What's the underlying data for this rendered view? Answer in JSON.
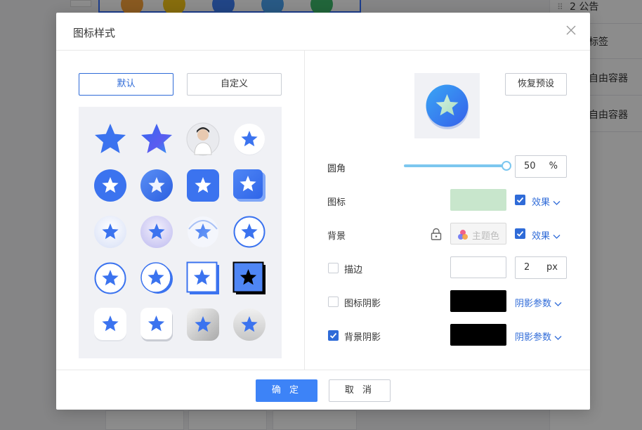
{
  "background": {
    "sidebar_items": [
      "2 公告",
      "标签",
      "自由容器",
      "自由容器"
    ]
  },
  "dialog": {
    "title": "图标样式",
    "close_label": "X",
    "tabs": [
      {
        "label": "默认",
        "active": true
      },
      {
        "label": "自定义",
        "active": false
      }
    ],
    "icon_styles": [
      "star-flat",
      "star-gradient",
      "avatar-photo",
      "star-in-white-circle",
      "star-in-blue-circle",
      "star-in-gradient-circle",
      "star-in-blue-square",
      "star-in-square-3d",
      "star-in-soft-circle",
      "star-in-lavender-circle",
      "star-in-glow-circle",
      "star-in-outline-circle",
      "star-in-outline-circle-thick",
      "star-in-outline-circle-shadow",
      "star-in-outline-square",
      "black-star-in-square",
      "star-in-white-rounded-square",
      "star-in-white-rounded-square-shadow",
      "star-in-grey-rounded-square",
      "star-in-grey-circle"
    ],
    "reset_label": "恢复预设",
    "settings": {
      "radius": {
        "label": "圆角",
        "value": "50",
        "unit": "%",
        "slider_fraction": 1.0
      },
      "icon": {
        "label": "图标",
        "color": "#c8e6cc",
        "effect_checked": true,
        "effect_label": "效果"
      },
      "background": {
        "label": "背景",
        "theme_label": "主题色",
        "effect_checked": true,
        "effect_label": "效果"
      },
      "stroke": {
        "label": "描边",
        "checked": false,
        "value": "2",
        "unit": "px"
      },
      "icon_shadow": {
        "label": "图标阴影",
        "checked": false,
        "color": "#000000",
        "params_label": "阴影参数"
      },
      "bg_shadow": {
        "label": "背景阴影",
        "checked": true,
        "color": "#000000",
        "params_label": "阴影参数"
      }
    },
    "footer": {
      "ok_label": "确 定",
      "cancel_label": "取 消"
    }
  },
  "colors": {
    "primary": "#2f6bd8",
    "ok_button": "#3d83f7",
    "slider": "#7cc7ef",
    "star_blue": "#3b73ef"
  }
}
